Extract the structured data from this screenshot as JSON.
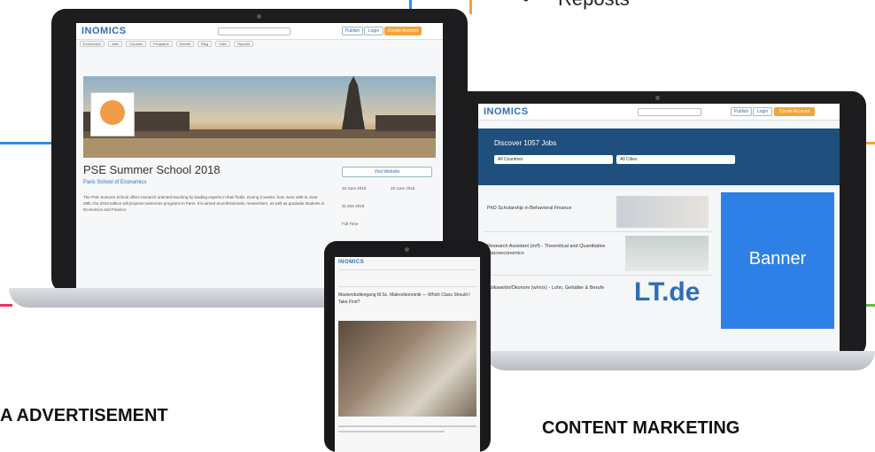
{
  "top_bullet": {
    "label": "Reposts"
  },
  "labels": {
    "left": "A ADVERTISEMENT",
    "right": "CONTENT MARKETING"
  },
  "colors": {
    "blue_line": "#2f8ee6",
    "orange_line": "#f2a33a",
    "red_line": "#e8335f",
    "green_line": "#66b84a",
    "brand": "#2f6eb5",
    "banner": "#2f80e6"
  },
  "left_site": {
    "logo": "INOMICS",
    "buttons": [
      "Publish",
      "Login",
      "Create Account"
    ],
    "nav": [
      "Economics",
      "Jobs",
      "Courses",
      "Programs",
      "Events",
      "Blog",
      "Calls",
      "Reports"
    ],
    "title": "PSE Summer School 2018",
    "school": "Paris School of Economics",
    "visit_button": "Visit Website",
    "body": "The PSE Summer School offers research oriented teaching by leading experts in their fields. During 2 weeks, from June 18th to June 29th, the 2018 edition will propose numerous programs in Paris. It is aimed at professionals, researchers, as well as graduate students in Economics and Finance.",
    "dates": [
      "18 June 2018",
      "29 June 2018",
      "31 Mar 2018"
    ],
    "fee": "Full Time"
  },
  "right_site": {
    "logo": "INOMICS",
    "buttons": [
      "Publish",
      "Login",
      "Create Account"
    ],
    "hero": "Discover 1057 Jobs",
    "filter_countries": "All Countries",
    "filter_cities": "All Cities",
    "jobs": [
      "PhD Scholarship in Behavioral Finance",
      "Research Assistant (m/f) - Theoretical and Quantitative Macroeconomics",
      "Volkswirtin/Ökonom (w/m/x) - Lohn, Gehälter & Berufe"
    ],
    "banner": "Banner",
    "brand_logo": "LT.de"
  },
  "tablet_site": {
    "logo": "INOMICS",
    "heading": "Masterstudiengang M.Sc. Makroökonomik — Which Class Should I Take First?"
  }
}
